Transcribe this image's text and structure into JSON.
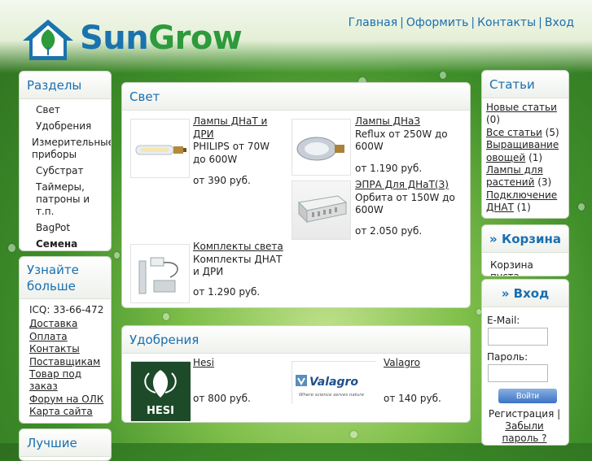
{
  "header": {
    "logo_sun": "Sun",
    "logo_grow": "Grow",
    "nav": [
      "Главная",
      "Оформить",
      "Контакты",
      "Вход"
    ]
  },
  "left": {
    "sections_title": "Разделы",
    "sections": [
      "Свет",
      "Удобрения",
      "Измерительные приборы",
      "Субстрат",
      "Таймеры, патроны и т.п.",
      "BagPot",
      "Семена"
    ],
    "more_title": "Узнайте больше",
    "icq": "ICQ: 33-66-472",
    "links": [
      "Доставка",
      "Оплата",
      "Контакты",
      "Поставщикам",
      "Товар под заказ",
      "Форум на ОЛК",
      "Карта сайта"
    ],
    "best_title": "Лучшие"
  },
  "light": {
    "title": "Свет",
    "products": [
      {
        "name": "Лампы ДНаТ и ДРИ",
        "desc": "PHILIPS от 70W до 600W",
        "price": "от 390 руб."
      },
      {
        "name": "Лампы ДНаЗ",
        "desc": "Reflux от 250W до 600W",
        "price": "от 1.190 руб."
      },
      {
        "name": "ЭПРА Для ДНаТ(З)",
        "desc": "Орбита от 150W до 600W",
        "price": "от 2.050 руб."
      },
      {
        "name": "Комплекты света",
        "desc": "Комплекты ДНАТ и ДРИ",
        "price": "от 1.290 руб."
      }
    ]
  },
  "fert": {
    "title": "Удобрения",
    "products": [
      {
        "name": "Hesi",
        "price": "от 800 руб.",
        "logo": "HESI"
      },
      {
        "name": "Valagro",
        "price": "от 140 руб.",
        "logo": "Valagro",
        "tagline": "Where science serves nature"
      }
    ]
  },
  "articles": {
    "title": "Статьи",
    "items": [
      {
        "label": "Новые статьи",
        "count": "(0)"
      },
      {
        "label": "Все статьи",
        "count": "(5)"
      },
      {
        "label": "Выращивание овощей",
        "count": "(1)"
      },
      {
        "label": "Лампы для растений",
        "count": "(3)"
      },
      {
        "label": "Подключение ДНАТ",
        "count": "(1)"
      }
    ]
  },
  "cart": {
    "title": "» Корзина",
    "empty": "Корзина пуста."
  },
  "login": {
    "title": "» Вход",
    "email_label": "E-Mail:",
    "password_label": "Пароль:",
    "submit": "Войти",
    "register": "Регистрация",
    "forgot": "Забыли пароль ?"
  },
  "colors": {
    "brand_blue": "#1a73ad",
    "brand_green": "#2d9a3c",
    "link_blue": "#1a6fb0"
  }
}
